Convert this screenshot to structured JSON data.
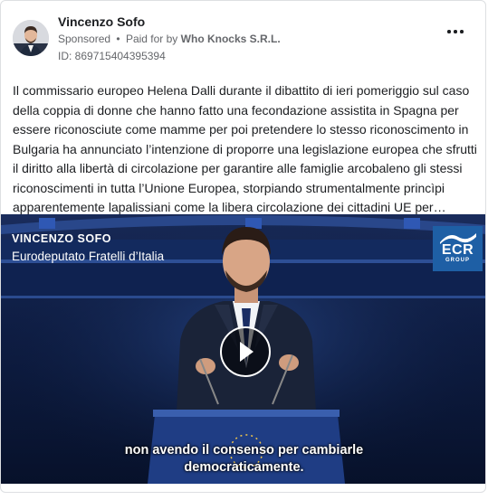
{
  "post": {
    "author": "Vincenzo Sofo",
    "sponsored": "Sponsored",
    "dot": "•",
    "paid_for_prefix": "Paid for by",
    "paid_for_by": "Who Knocks S.R.L.",
    "ad_id": "ID: 869715404395394",
    "text": "Il commissario europeo Helena Dalli durante il dibattito di ieri pomeriggio sul caso della coppia di donne che hanno fatto una fecondazione assistita in Spagna per essere riconosciute come mamme per poi pretendere lo stesso riconoscimento in Bulgaria ha annunciato l’intenzione di proporre una legislazione europea che sfrutti il diritto alla libertà di circolazione per garantire alle famiglie arcobaleno gli stessi riconoscimenti in tutta l’Unione Europea, storpiando strumentalmente princìpi apparentemente lapalissiani come la libera circolazione dei cittadini UE per…"
  },
  "icons": {
    "more": "more-options-icon",
    "play": "play-icon",
    "logo": "ecr-group-logo"
  },
  "video": {
    "speaker_name": "VINCENZO SOFO",
    "speaker_role": "Eurodeputato Fratelli d’Italia",
    "logo_text": "ECR",
    "logo_sub": "GROUP",
    "subtitle_line1": "non avendo il consenso per cambiarle",
    "subtitle_line2": "democraticamente."
  },
  "colors": {
    "ecr_blue": "#1e5fa5",
    "hall_blue": "#0c1a3a",
    "meta_gray": "#65676b"
  }
}
